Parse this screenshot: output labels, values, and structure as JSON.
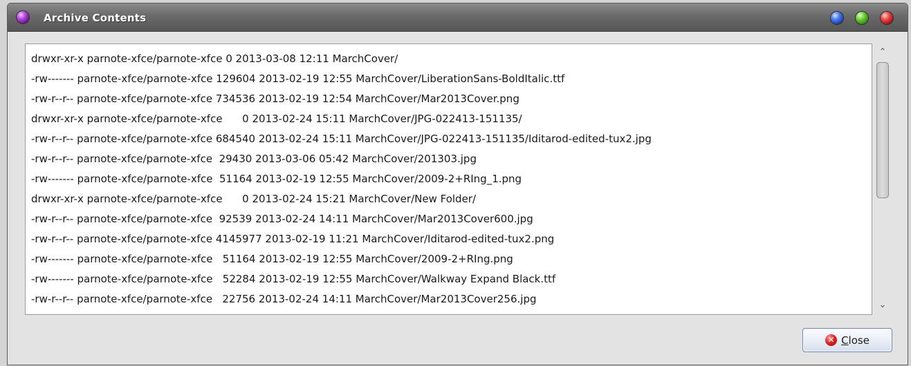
{
  "window": {
    "title": "Archive Contents",
    "controls": {
      "left_icon": "purple-orb-icon",
      "buttons": [
        {
          "name": "minimize",
          "icon": "blue-orb-icon",
          "color": "#3d63d6"
        },
        {
          "name": "maximize",
          "icon": "green-orb-icon",
          "color": "#4fb52a"
        },
        {
          "name": "close",
          "icon": "red-orb-icon",
          "color": "#d9272e"
        }
      ]
    }
  },
  "listing": {
    "lines": [
      "drwxr-xr-x parnote-xfce/parnote-xfce 0 2013-03-08 12:11 MarchCover/",
      "-rw------- parnote-xfce/parnote-xfce 129604 2013-02-19 12:55 MarchCover/LiberationSans-BoldItalic.ttf",
      "-rw-r--r-- parnote-xfce/parnote-xfce 734536 2013-02-19 12:54 MarchCover/Mar2013Cover.png",
      "drwxr-xr-x parnote-xfce/parnote-xfce      0 2013-02-24 15:11 MarchCover/JPG-022413-151135/",
      "-rw-r--r-- parnote-xfce/parnote-xfce 684540 2013-02-24 15:11 MarchCover/JPG-022413-151135/Iditarod-edited-tux2.jpg",
      "-rw-r--r-- parnote-xfce/parnote-xfce  29430 2013-03-06 05:42 MarchCover/201303.jpg",
      "-rw------- parnote-xfce/parnote-xfce  51164 2013-02-19 12:55 MarchCover/2009-2+RIng_1.png",
      "drwxr-xr-x parnote-xfce/parnote-xfce      0 2013-02-24 15:21 MarchCover/New Folder/",
      "-rw-r--r-- parnote-xfce/parnote-xfce  92539 2013-02-24 14:11 MarchCover/Mar2013Cover600.jpg",
      "-rw-r--r-- parnote-xfce/parnote-xfce 4145977 2013-02-19 11:21 MarchCover/Iditarod-edited-tux2.png",
      "-rw------- parnote-xfce/parnote-xfce   51164 2013-02-19 12:55 MarchCover/2009-2+RIng.png",
      "-rw------- parnote-xfce/parnote-xfce   52284 2013-02-19 12:55 MarchCover/Walkway Expand Black.ttf",
      "-rw-r--r-- parnote-xfce/parnote-xfce   22756 2013-02-24 14:11 MarchCover/Mar2013Cover256.jpg"
    ]
  },
  "scrollbar": {
    "up_icon": "chevron-up-icon",
    "down_icon": "chevron-down-icon",
    "thumb_fraction": 0.58,
    "position_fraction": 0.0
  },
  "footer": {
    "close_button": {
      "mnemonic": "C",
      "rest": "lose",
      "icon": "close-icon"
    }
  }
}
